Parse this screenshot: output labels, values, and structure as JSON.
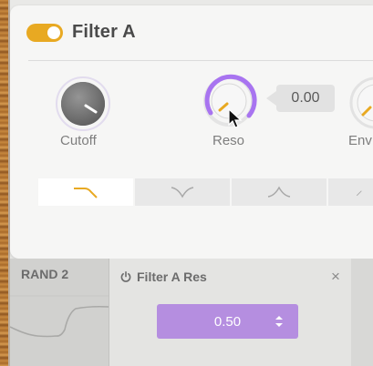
{
  "module": {
    "enabled": true,
    "title": "Filter A",
    "toggle_color": "#e8a922"
  },
  "knobs": [
    {
      "label": "Cutoff",
      "value_fraction": 0.88
    },
    {
      "label": "Reso",
      "value_fraction": 0.0,
      "modulation_color": "#a874f0"
    },
    {
      "label": "Env",
      "value_fraction": 0.0
    }
  ],
  "value_readout": "0.00",
  "filter_types": [
    "low-pass",
    "notch",
    "band-pass",
    "high-pass"
  ],
  "active_filter_type": "low-pass",
  "modulation": {
    "source_title": "RAND 2",
    "target_title": "Filter A Res",
    "amount": "0.50",
    "close_label": "×",
    "accent": "#b58ee0"
  }
}
